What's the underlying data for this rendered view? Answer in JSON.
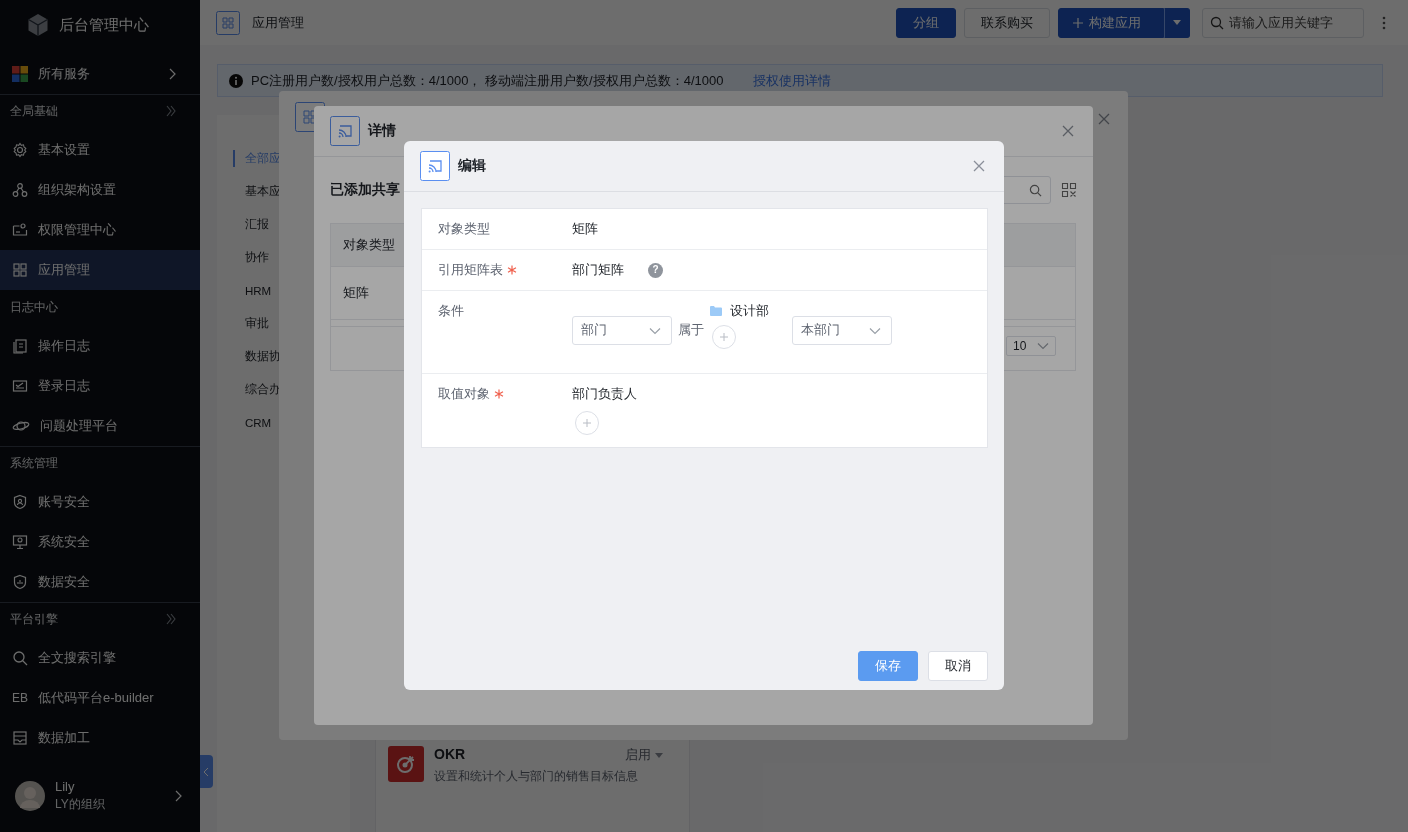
{
  "sidebar": {
    "title": "后台管理中心",
    "all_services": "所有服务",
    "groups": [
      {
        "label": "全局基础",
        "expandable": true,
        "divider": true,
        "items": [
          {
            "label": "基本设置",
            "selected": false
          },
          {
            "label": "组织架构设置",
            "selected": false
          },
          {
            "label": "权限管理中心",
            "selected": false
          },
          {
            "label": "应用管理",
            "selected": true
          }
        ]
      },
      {
        "label": "日志中心",
        "expandable": false,
        "divider": false,
        "items": [
          {
            "label": "操作日志",
            "selected": false
          },
          {
            "label": "登录日志",
            "selected": false
          },
          {
            "label": "问题处理平台",
            "selected": false
          }
        ]
      },
      {
        "label": "系统管理",
        "expandable": false,
        "divider": true,
        "items": [
          {
            "label": "账号安全",
            "selected": false
          },
          {
            "label": "系统安全",
            "selected": false
          },
          {
            "label": "数据安全",
            "selected": false
          }
        ]
      },
      {
        "label": "平台引擎",
        "expandable": true,
        "divider": true,
        "items": [
          {
            "label": "全文搜索引擎",
            "selected": false
          },
          {
            "label": "低代码平台e-builder",
            "icon_text": "EB",
            "selected": false
          },
          {
            "label": "数据加工",
            "selected": false
          }
        ]
      }
    ],
    "user": {
      "name": "Lily",
      "org": "LY的组织"
    }
  },
  "header": {
    "title": "应用管理",
    "buttons": [
      {
        "label": "分组",
        "kind": "primary"
      },
      {
        "label": "联系购买",
        "kind": "default"
      },
      {
        "label": "构建应用",
        "kind": "split"
      }
    ],
    "search": {
      "placeholder": "请输入应用关键字"
    }
  },
  "notice": {
    "text": "PC注册用户数/授权用户总数：4/1000， 移动端注册用户数/授权用户总数：4/1000",
    "link": "授权使用详情"
  },
  "categories": [
    {
      "label": "全部应",
      "selected": true
    },
    {
      "label": "基本应",
      "selected": false
    },
    {
      "label": "汇报",
      "selected": false
    },
    {
      "label": "协作",
      "selected": false
    },
    {
      "label": "HRM",
      "selected": false
    },
    {
      "label": "审批",
      "selected": false
    },
    {
      "label": "数据协",
      "selected": false
    },
    {
      "label": "综合办",
      "selected": false
    },
    {
      "label": "CRM",
      "selected": false
    }
  ],
  "apps": [
    {
      "name": "OKR",
      "status": "启用",
      "description": "设置和统计个人与部门的销售目标信息"
    }
  ],
  "detail_dialog": {
    "title": "详情",
    "section_title": "已添加共享",
    "columns": [
      "对象类型"
    ],
    "rows": [
      [
        "矩阵"
      ]
    ],
    "page_size": "10"
  },
  "edit_dialog": {
    "title": "编辑",
    "fields": [
      {
        "kind": "text",
        "label": "对象类型",
        "required": false,
        "value": "矩阵"
      },
      {
        "kind": "help",
        "label": "引用矩阵表",
        "required": true,
        "value": "部门矩阵",
        "help_icon": "?"
      },
      {
        "kind": "condition",
        "label": "条件",
        "required": false,
        "field": "部门",
        "operator": "属于",
        "target": "设计部",
        "scope": "本部门"
      },
      {
        "kind": "picker",
        "label": "取值对象",
        "required": true,
        "value": "部门负责人"
      }
    ],
    "buttons": [
      {
        "label": "保存",
        "primary": true
      },
      {
        "label": "取消",
        "primary": false
      }
    ]
  }
}
